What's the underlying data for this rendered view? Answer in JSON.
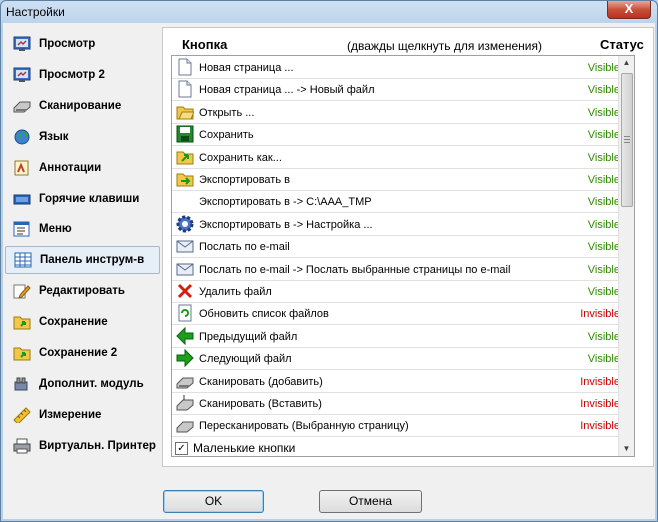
{
  "window": {
    "title": "Настройки",
    "close_glyph": "X"
  },
  "sidebar": {
    "items": [
      {
        "label": "Просмотр",
        "icon": "view-monitor-icon",
        "selected": false
      },
      {
        "label": "Просмотр 2",
        "icon": "view-monitor-2-icon",
        "selected": false
      },
      {
        "label": "Сканирование",
        "icon": "scanner-icon",
        "selected": false
      },
      {
        "label": "Язык",
        "icon": "globe-icon",
        "selected": false
      },
      {
        "label": "Аннотации",
        "icon": "annotation-icon",
        "selected": false
      },
      {
        "label": "Горячие клавиши",
        "icon": "keyboard-icon",
        "selected": false
      },
      {
        "label": "Меню",
        "icon": "menu-window-icon",
        "selected": false
      },
      {
        "label": "Панель инструм-в",
        "icon": "toolbar-grid-icon",
        "selected": true
      },
      {
        "label": "Редактировать",
        "icon": "edit-pencil-icon",
        "selected": false
      },
      {
        "label": "Сохранение",
        "icon": "save-folder-icon",
        "selected": false
      },
      {
        "label": "Сохранение 2",
        "icon": "save-folder-2-icon",
        "selected": false
      },
      {
        "label": "Дополнит. модуль",
        "icon": "plugin-icon",
        "selected": false
      },
      {
        "label": "Измерение",
        "icon": "ruler-icon",
        "selected": false
      },
      {
        "label": "Виртуальн. Принтер",
        "icon": "printer-icon",
        "selected": false
      }
    ]
  },
  "panel": {
    "col_button": "Кнопка",
    "col_hint": "(дважды щелкнуть для изменения)",
    "col_status": "Статус",
    "rows": [
      {
        "name": "Новая страница ...",
        "status": "Visible",
        "icon": "new-page-icon"
      },
      {
        "name": "Новая страница ... -> Новый файл",
        "status": "Visible",
        "icon": "new-file-icon"
      },
      {
        "name": "Открыть ...",
        "status": "Visible",
        "icon": "open-folder-icon"
      },
      {
        "name": "Сохранить",
        "status": "Visible",
        "icon": "save-disk-icon"
      },
      {
        "name": "Сохранить как...",
        "status": "Visible",
        "icon": "save-as-icon"
      },
      {
        "name": "Экспортировать в",
        "status": "Visible",
        "icon": "export-icon"
      },
      {
        "name": "Экспортировать в -> C:\\AAA_TMP",
        "status": "Visible",
        "icon": ""
      },
      {
        "name": "Экспортировать в -> Настройка ...",
        "status": "Visible",
        "icon": "gear-icon"
      },
      {
        "name": "Послать по e-mail",
        "status": "Visible",
        "icon": "email-icon"
      },
      {
        "name": "Послать по e-mail -> Послать выбранные страницы по e-mail",
        "status": "Visible",
        "icon": "email-pages-icon"
      },
      {
        "name": "Удалить файл",
        "status": "Visible",
        "icon": "delete-icon"
      },
      {
        "name": "Обновить список файлов",
        "status": "Invisible",
        "icon": "refresh-icon"
      },
      {
        "name": "Предыдущий файл",
        "status": "Visible",
        "icon": "arrow-left-icon"
      },
      {
        "name": "Следующий файл",
        "status": "Visible",
        "icon": "arrow-right-icon"
      },
      {
        "name": "Сканировать (добавить)",
        "status": "Invisible",
        "icon": "scan-add-icon"
      },
      {
        "name": "Сканировать (Вставить)",
        "status": "Invisible",
        "icon": "scan-insert-icon"
      },
      {
        "name": "Пересканировать (Выбранную страницу)",
        "status": "Invisible",
        "icon": "rescan-icon"
      }
    ],
    "small_buttons_label": "Маленькие кнопки",
    "small_buttons_checked": true
  },
  "buttons": {
    "ok": "OK",
    "cancel": "Отмена"
  },
  "colors": {
    "visible": "#2e8b00",
    "invisible": "#cc0000",
    "selection": "#e6eef7"
  }
}
